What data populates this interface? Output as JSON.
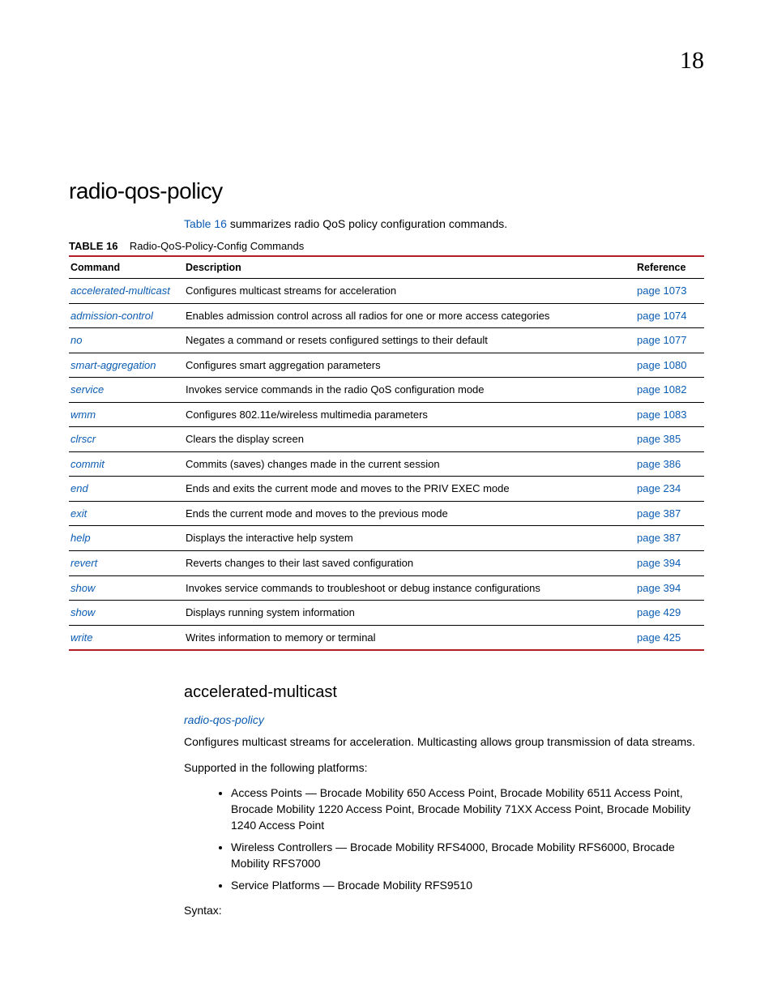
{
  "chapter_number": "18",
  "page_title": "radio-qos-policy",
  "intro": {
    "link_text": "Table 16",
    "rest": " summarizes radio QoS policy configuration commands."
  },
  "table": {
    "caption_label": "TABLE 16",
    "caption_text": "Radio-QoS-Policy-Config Commands",
    "headers": {
      "command": "Command",
      "description": "Description",
      "reference": "Reference"
    },
    "rows": [
      {
        "command": "accelerated-multicast",
        "description": "Configures multicast streams for acceleration",
        "reference": "page 1073"
      },
      {
        "command": "admission-control",
        "description": "Enables admission control across all radios for one or more access categories",
        "reference": "page 1074"
      },
      {
        "command": "no",
        "description": "Negates a command or resets configured settings to their default",
        "reference": "page 1077"
      },
      {
        "command": "smart-aggregation",
        "description": "Configures smart aggregation parameters",
        "reference": "page 1080"
      },
      {
        "command": "service",
        "description": "Invokes service commands in the radio QoS configuration mode",
        "reference": "page 1082"
      },
      {
        "command": "wmm",
        "description": "Configures 802.11e/wireless multimedia parameters",
        "reference": "page 1083"
      },
      {
        "command": "clrscr",
        "description": "Clears the display screen",
        "reference": "page 385"
      },
      {
        "command": "commit",
        "description": "Commits (saves) changes made in the current session",
        "reference": "page 386"
      },
      {
        "command": "end",
        "description": "Ends and exits the current mode and moves to the PRIV EXEC mode",
        "reference": "page 234"
      },
      {
        "command": "exit",
        "description": "Ends the current mode and moves to the previous mode",
        "reference": "page 387"
      },
      {
        "command": "help",
        "description": "Displays the interactive help system",
        "reference": "page 387"
      },
      {
        "command": "revert",
        "description": "Reverts changes to their last saved configuration",
        "reference": "page 394"
      },
      {
        "command": "show",
        "description": "Invokes service commands to troubleshoot or debug                          instance configurations",
        "reference": "page 394"
      },
      {
        "command": "show",
        "description": "Displays running system information",
        "reference": "page 429"
      },
      {
        "command": "write",
        "description": "Writes information to memory or terminal",
        "reference": "page 425"
      }
    ]
  },
  "section": {
    "heading": "accelerated-multicast",
    "parent_link": "radio-qos-policy",
    "body1": "Configures multicast streams for acceleration. Multicasting allows group transmission of data streams.",
    "body2": "Supported in the following platforms:",
    "platforms": [
      "Access Points — Brocade Mobility 650 Access Point, Brocade Mobility 6511 Access Point, Brocade Mobility 1220 Access Point, Brocade Mobility 71XX Access Point, Brocade Mobility 1240 Access Point",
      "Wireless Controllers — Brocade Mobility RFS4000, Brocade Mobility RFS6000, Brocade Mobility RFS7000",
      "Service Platforms — Brocade Mobility RFS9510"
    ],
    "syntax_label": "Syntax:"
  }
}
